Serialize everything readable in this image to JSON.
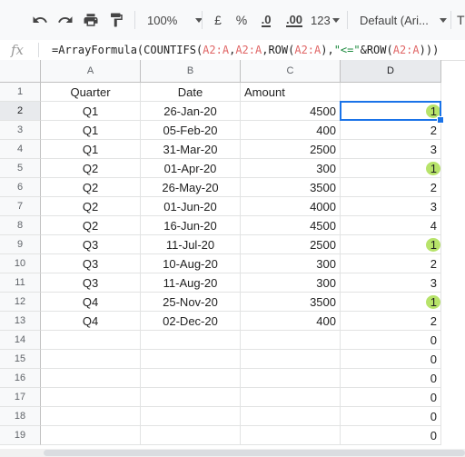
{
  "toolbar": {
    "zoom": "100%",
    "currency": "£",
    "percent": "%",
    "decrease_decimals": ".0",
    "increase_decimals": ".00",
    "more_formats": "123",
    "font": "Default (Ari...",
    "overflow": "T"
  },
  "formula_bar": {
    "fx_label": "fx",
    "formula": "=ArrayFormula(COUNTIFS(A2:A,A2:A,ROW(A2:A),\"<=\"&ROW(A2:A)))"
  },
  "columns": [
    "A",
    "B",
    "C",
    "D"
  ],
  "rows": [
    {
      "num": "1",
      "a": "Quarter",
      "b": "Date",
      "c": "Amount",
      "d": ""
    },
    {
      "num": "2",
      "a": "Q1",
      "b": "26-Jan-20",
      "c": "4500",
      "d": "1"
    },
    {
      "num": "3",
      "a": "Q1",
      "b": "05-Feb-20",
      "c": "400",
      "d": "2"
    },
    {
      "num": "4",
      "a": "Q1",
      "b": "31-Mar-20",
      "c": "2500",
      "d": "3"
    },
    {
      "num": "5",
      "a": "Q2",
      "b": "01-Apr-20",
      "c": "300",
      "d": "1"
    },
    {
      "num": "6",
      "a": "Q2",
      "b": "26-May-20",
      "c": "3500",
      "d": "2"
    },
    {
      "num": "7",
      "a": "Q2",
      "b": "01-Jun-20",
      "c": "4000",
      "d": "3"
    },
    {
      "num": "8",
      "a": "Q2",
      "b": "16-Jun-20",
      "c": "4500",
      "d": "4"
    },
    {
      "num": "9",
      "a": "Q3",
      "b": "11-Jul-20",
      "c": "2500",
      "d": "1"
    },
    {
      "num": "10",
      "a": "Q3",
      "b": "10-Aug-20",
      "c": "300",
      "d": "2"
    },
    {
      "num": "11",
      "a": "Q3",
      "b": "11-Aug-20",
      "c": "300",
      "d": "3"
    },
    {
      "num": "12",
      "a": "Q4",
      "b": "25-Nov-20",
      "c": "3500",
      "d": "1"
    },
    {
      "num": "13",
      "a": "Q4",
      "b": "02-Dec-20",
      "c": "400",
      "d": "2"
    },
    {
      "num": "14",
      "a": "",
      "b": "",
      "c": "",
      "d": "0"
    },
    {
      "num": "15",
      "a": "",
      "b": "",
      "c": "",
      "d": "0"
    },
    {
      "num": "16",
      "a": "",
      "b": "",
      "c": "",
      "d": "0"
    },
    {
      "num": "17",
      "a": "",
      "b": "",
      "c": "",
      "d": "0"
    },
    {
      "num": "18",
      "a": "",
      "b": "",
      "c": "",
      "d": "0"
    },
    {
      "num": "19",
      "a": "",
      "b": "",
      "c": "",
      "d": "0"
    }
  ],
  "selected_cell": "D2",
  "highlighted_rows": [
    "2",
    "5",
    "9",
    "12"
  ],
  "colors": {
    "selection": "#1a73e8",
    "highlight": "#b7e36a",
    "formula_reference": "#e06666",
    "formula_string": "#1c8a3e"
  }
}
